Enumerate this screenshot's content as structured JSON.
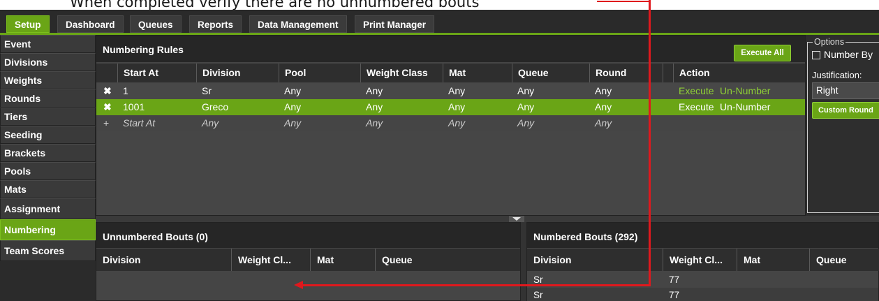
{
  "annotation": {
    "caption": "When completed verify there are no unnumbered bouts",
    "color": "#e0181d"
  },
  "tabs": [
    {
      "label": "Setup",
      "active": true
    },
    {
      "label": "Dashboard",
      "active": false
    },
    {
      "label": "Queues",
      "active": false
    },
    {
      "label": "Reports",
      "active": false
    },
    {
      "label": "Data Management",
      "active": false
    },
    {
      "label": "Print Manager",
      "active": false
    }
  ],
  "sidebar": {
    "items": [
      {
        "label": "Event"
      },
      {
        "label": "Divisions"
      },
      {
        "label": "Weights"
      },
      {
        "label": "Rounds"
      },
      {
        "label": "Tiers"
      },
      {
        "label": "Seeding"
      },
      {
        "label": "Brackets"
      },
      {
        "label": "Pools"
      },
      {
        "label": "Mats"
      },
      {
        "label": "Assignment"
      },
      {
        "label": "Numbering",
        "active": true
      },
      {
        "label": "Team Scores"
      }
    ]
  },
  "rules": {
    "title": "Numbering Rules",
    "execute_all": "Execute All",
    "columns": [
      "Start At",
      "Division",
      "Pool",
      "Weight Class",
      "Mat",
      "Queue",
      "Round",
      "Action"
    ],
    "rows": [
      {
        "icon": "✖",
        "start_at": "1",
        "division": "Sr",
        "pool": "Any",
        "weight_class": "Any",
        "mat": "Any",
        "queue": "Any",
        "round": "Any",
        "execute": "Execute",
        "unnumber": "Un-Number",
        "selected": false
      },
      {
        "icon": "✖",
        "start_at": "1001",
        "division": "Greco",
        "pool": "Any",
        "weight_class": "Any",
        "mat": "Any",
        "queue": "Any",
        "round": "Any",
        "execute": "Execute",
        "unnumber": "Un-Number",
        "selected": true
      }
    ],
    "new_row": {
      "icon": "+",
      "start_at": "Start At",
      "division": "Any",
      "pool": "Any",
      "weight_class": "Any",
      "mat": "Any",
      "queue": "Any",
      "round": "Any"
    }
  },
  "options": {
    "legend": "Options",
    "number_by": "Number By",
    "justification_label": "Justification:",
    "justification_value": "Right",
    "custom_button": "Custom Round"
  },
  "unnumbered": {
    "title": "Unnumbered Bouts (0)",
    "columns": [
      "Division",
      "Weight Cl...",
      "Mat",
      "Queue"
    ]
  },
  "numbered": {
    "title": "Numbered Bouts (292)",
    "columns": [
      "Division",
      "Weight Cl...",
      "Mat",
      "Queue"
    ],
    "rows": [
      {
        "division": "Sr",
        "weight": "77"
      },
      {
        "division": "Sr",
        "weight": "77"
      }
    ]
  },
  "colors": {
    "accent_green": "#6aa516",
    "panel_dark": "#262626",
    "panel_mid": "#464646"
  }
}
